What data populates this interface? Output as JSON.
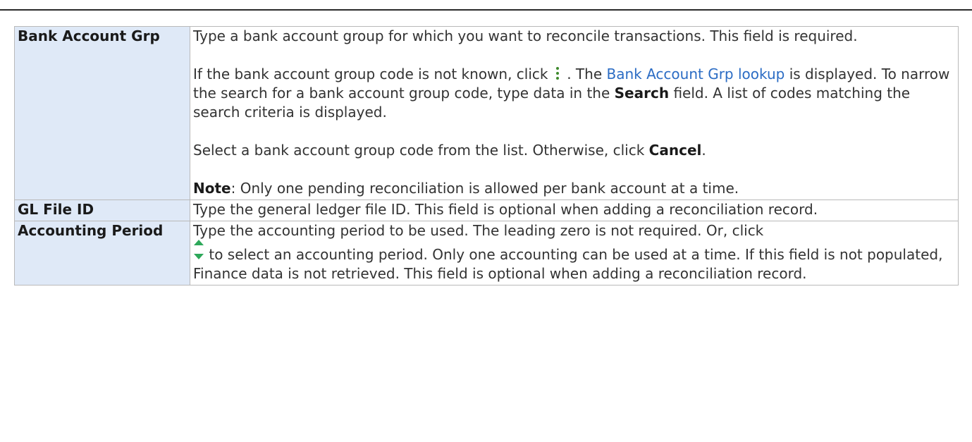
{
  "rows": [
    {
      "name": "Bank Account Grp",
      "p1": "Type a bank account group for which you want to reconcile transactions. This field is required.",
      "p2_pre": "If the bank account group code is not known, click",
      "p2_mid": ". The",
      "p2_link": "Bank Account Grp lookup",
      "p2_post_a": "is displayed. To narrow the search for a bank account group code, type data in the",
      "p2_bold": "Search",
      "p2_post_b": "field. A list of codes matching the search criteria is displayed.",
      "p3_pre": "Select a bank account group code from the list. Otherwise, click",
      "p3_bold": "Cancel",
      "p3_post": ".",
      "note_label": "Note",
      "note_text": ": Only one pending reconciliation is allowed per bank account at a time."
    },
    {
      "name": "GL File ID",
      "text": "Type the general ledger file ID. This field is optional when adding a reconciliation record."
    },
    {
      "name": "Accounting Period",
      "text_pre": "Type the accounting period to be used. The leading zero is not required. Or, click",
      "text_post": "to select an accounting period. Only one accounting can be used at a time. If this field is not populated, Finance data is not retrieved. This field is optional when adding a reconciliation record."
    }
  ],
  "icons": {
    "lookup": "kebab-vertical-icon",
    "spinner": "up-down-spinner-icon"
  }
}
